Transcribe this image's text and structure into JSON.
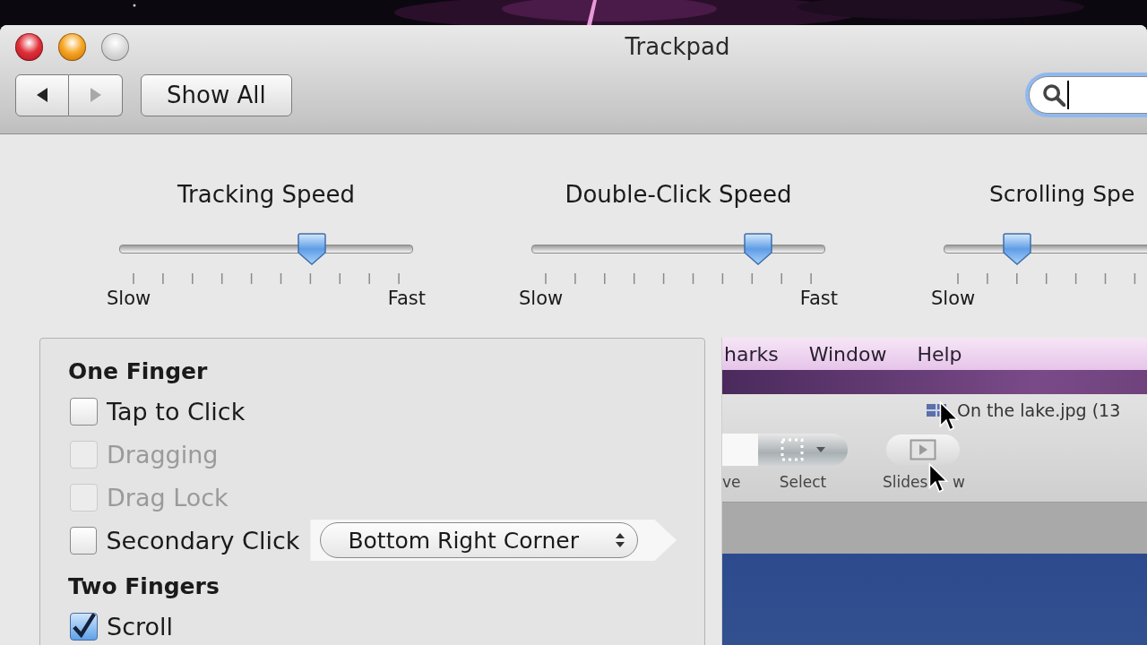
{
  "window": {
    "title": "Trackpad"
  },
  "toolbar": {
    "nav": [
      {
        "kind": "back",
        "disabled": false
      },
      {
        "kind": "forward",
        "disabled": true
      }
    ],
    "show_all": "Show All",
    "search": {
      "focused": true
    }
  },
  "sliders": [
    {
      "title": "Tracking Speed",
      "level": 0.655,
      "min_label": "Slow",
      "max_label": "Fast"
    },
    {
      "title": "Double-Click Speed",
      "level": 0.77,
      "min_label": "Slow",
      "max_label": "Fast"
    },
    {
      "title": "Scrolling Spe",
      "level": 0.25,
      "min_label": "Slow"
    }
  ],
  "sections": [
    {
      "heading": "One Finger",
      "options": [
        {
          "label": "Tap to Click",
          "checked": false,
          "disabled": false
        },
        {
          "label": "Dragging",
          "checked": false,
          "disabled": true
        },
        {
          "label": "Drag Lock",
          "checked": false,
          "disabled": true
        },
        {
          "label": "Secondary Click",
          "checked": false,
          "disabled": false,
          "highlighted": true,
          "popup": "Bottom Right Corner"
        }
      ]
    },
    {
      "heading": "Two Fingers",
      "options": [
        {
          "label": "Scroll",
          "checked": true,
          "disabled": false
        }
      ]
    }
  ],
  "preview": {
    "menu": [
      "harks",
      "Window",
      "Help"
    ],
    "file_title": "On the lake.jpg (13",
    "tools": [
      {
        "kind": "partial",
        "label_parts": [
          "ve"
        ]
      },
      {
        "kind": "dropdown",
        "label_parts": [
          "Select"
        ]
      },
      {
        "kind": "play",
        "label_parts": [
          "Slides",
          "w"
        ]
      }
    ]
  }
}
